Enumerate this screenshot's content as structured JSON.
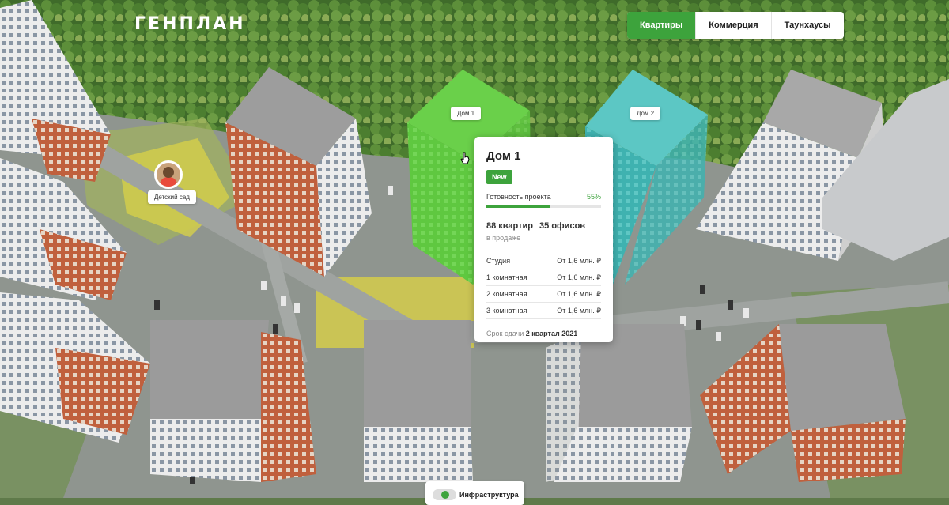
{
  "brand": {
    "logo": "ГЕНПЛАН"
  },
  "tabs": [
    {
      "label": "Квартиры",
      "active": true
    },
    {
      "label": "Коммерция",
      "active": false
    },
    {
      "label": "Таунхаусы",
      "active": false
    }
  ],
  "markers": {
    "house1": "Дом 1",
    "house2": "Дом 2",
    "kindergarten": "Детский сад"
  },
  "card": {
    "title": "Дом 1",
    "badge": "New",
    "readiness_label": "Готовность проекта",
    "readiness_value": "55%",
    "readiness_fraction": 0.55,
    "apartments": "88 квартир",
    "offices": "35 офисов",
    "on_sale": "в продаже",
    "rows": [
      {
        "type": "Студия",
        "price": "От 1,6 млн. ₽"
      },
      {
        "type": "1 комнатная",
        "price": "От 1,6 млн. ₽"
      },
      {
        "type": "2 комнатная",
        "price": "От 1,6 млн. ₽"
      },
      {
        "type": "3 комнатная",
        "price": "От 1,6 млн. ₽"
      }
    ],
    "due_label": "Срок сдачи",
    "due_value": "2 квартал 2021"
  },
  "infrastructure": {
    "label": "Инфраструктура",
    "enabled": true
  },
  "colors": {
    "accent": "#3da33c",
    "house1_highlight": "#5fcc3c",
    "house2_highlight": "#4fc0bd"
  }
}
